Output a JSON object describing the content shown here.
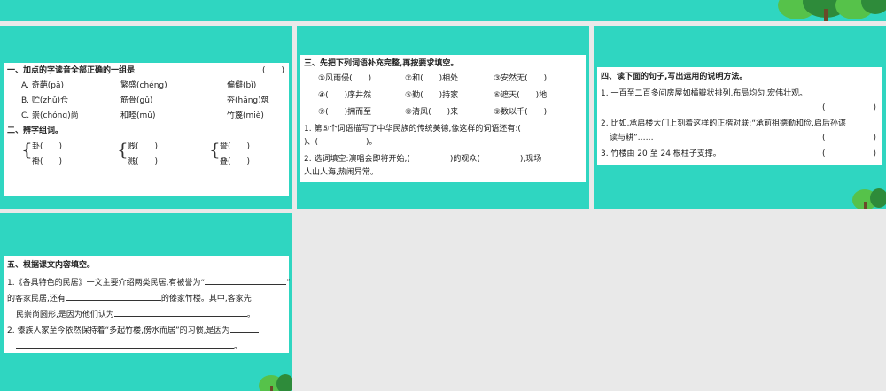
{
  "s1": {
    "q1": {
      "title": "一、加点的字读音全部正确的一组是",
      "paren": "(　　)",
      "rows": [
        [
          "A. 奇葩(pā)",
          "繁盛(chéng)",
          "偏僻(bì)"
        ],
        [
          "B. 贮(zhǔ)仓",
          "筋骨(gǔ)",
          "夯(hāng)筑"
        ],
        [
          "C. 崇(chóng)尚",
          "和睦(mǔ)",
          "竹篾(miè)"
        ]
      ]
    },
    "q2": {
      "title": "二、辨字组词。",
      "groups": [
        [
          "卦(　　)",
          "褂(　　)"
        ],
        [
          "贱(　　)",
          "溅(　　)"
        ],
        [
          "誉(　　)",
          "叠(　　)"
        ]
      ]
    }
  },
  "s2": {
    "title": "三、先把下列词语补充完整,再按要求填空。",
    "rows": [
      [
        "①风雨侵(　　)",
        "②和(　　)相处",
        "③安然无(　　)"
      ],
      [
        "④(　　)序井然",
        "⑤勤(　　)持家",
        "⑥遮天(　　)地"
      ],
      [
        "⑦(　　)拥而至",
        "⑧清风(　　)来",
        "⑨数以千(　　)"
      ]
    ],
    "q1a": "1. 第⑤个词语描写了中华民族的传统美德,像这样的词语还有:(",
    "q1b": ")、(　　　　　　)。",
    "q2a": "2. 选词填空:演唱会即将开始,(　　　　　)的观众(　　　　　),现场",
    "q2b": "人山人海,热闹异常。"
  },
  "s3": {
    "title": "四、读下面的句子,写出运用的说明方法。",
    "l1": "1. 一百至二百多间房屋如橘瓣状排列,布局均匀,宏伟壮观。",
    "p1": "(　　　　　　)",
    "l2a": "2. 比如,承启楼大门上刻着这样的正楷对联:“承前祖德勤和俭,启后孙谋",
    "l2b": "读与耕”……",
    "p2": "(　　　　　　)",
    "l3": "3. 竹楼由 20 至 24 根柱子支撑。",
    "p3": "(　　　　　　)"
  },
  "s4": {
    "title": "五、根据课文内容填空。",
    "l1a": "1.《各具特色的民居》一文主要介绍两类民居,有被誉为“",
    "l1b": "”",
    "l2a": "的客家民居,还有",
    "l2b": "的傣家竹楼。其中,客家先",
    "l3a": "民崇尚圆形,是因为他们认为",
    "l3b": "。",
    "l4": "2. 傣族人家至今依然保持着“多起竹楼,傍水而居”的习惯,是因为",
    "l5b": "。"
  },
  "colors": {
    "slide_bg": "#2fd6c1",
    "tree_dark": "#2e8b3a",
    "tree_light": "#56c24a"
  }
}
